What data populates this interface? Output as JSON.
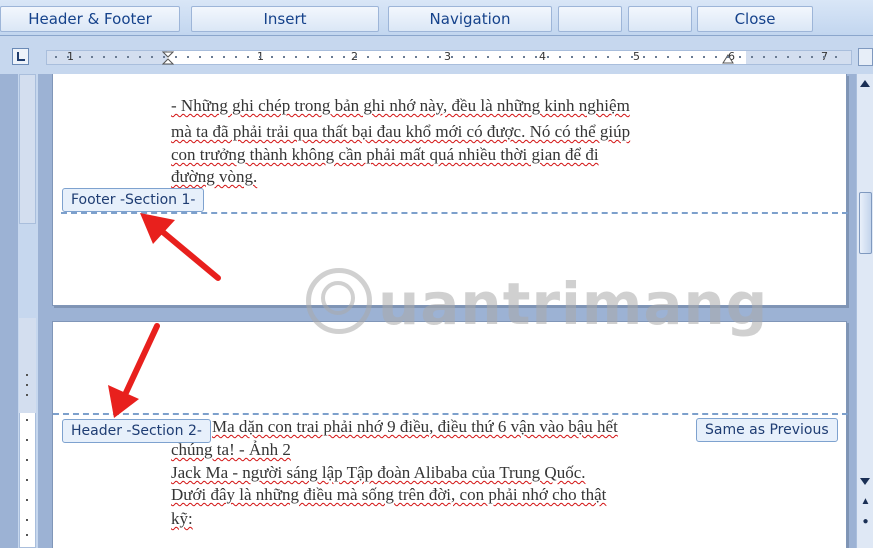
{
  "ribbon": {
    "tabs": [
      {
        "label": "Header & Footer"
      },
      {
        "label": "Insert"
      },
      {
        "label": "Navigation"
      },
      {
        "label": ""
      },
      {
        "label": ""
      },
      {
        "label": "Close"
      }
    ]
  },
  "ruler": {
    "numbers": [
      "1",
      "1",
      "2",
      "3",
      "4",
      "5",
      "6",
      "7"
    ]
  },
  "page1": {
    "lines": [
      "- Những ghi chép trong bản ghi nhớ này, đều là những kinh nghiệm",
      "mà ta đã phải trải qua thất bại đau khổ mới có được. Nó có thể giúp",
      "con trưởng thành không cần phải mất quá nhiều thời gian để đi",
      "đường vòng."
    ],
    "footer_tab": "Footer -Section 1-"
  },
  "page2": {
    "header_tab": "Header -Section 2-",
    "same_as_previous": "Same as Previous",
    "lines": [
      "Ma dặn con trai phải nhớ 9 điều, điều thứ 6 vận vào bậu hết",
      "chúng ta! - Ảnh 2",
      "Jack Ma - người sáng lập Tập đoàn Alibaba của Trung Quốc.",
      "Dưới đây là những điều mà sống trên đời, con phải nhớ cho thật",
      "kỹ:"
    ]
  },
  "watermark": {
    "text": "uantrimang"
  },
  "colors": {
    "arrow": "#e8201d",
    "dashed_line": "#7da0cc",
    "tab_bg": "#e7f0fb"
  },
  "icons": [
    "ruler-tab-stop-icon",
    "view-ruler-icon",
    "scroll-up-icon",
    "scroll-down-icon",
    "previous-page-icon",
    "select-browse-object-icon"
  ]
}
